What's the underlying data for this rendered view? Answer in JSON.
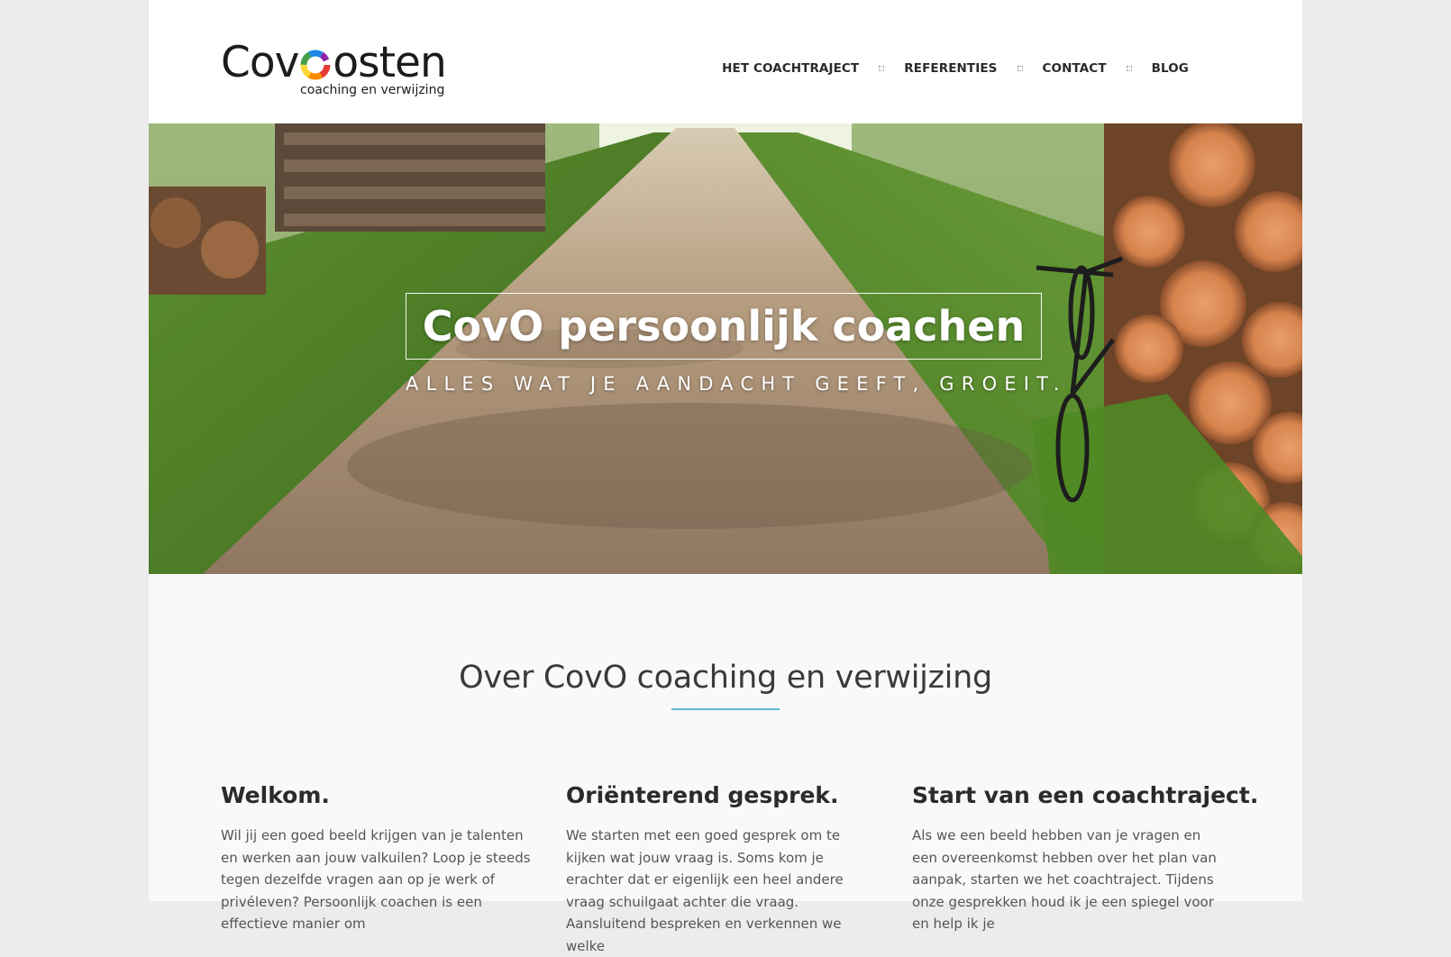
{
  "header": {
    "logo": {
      "word_start": "Cov",
      "word_end": "osten",
      "tagline": "coaching en verwijzing"
    },
    "nav": [
      {
        "label": "HET COACHTRAJECT"
      },
      {
        "label": "REFERENTIES"
      },
      {
        "label": "CONTACT"
      },
      {
        "label": "BLOG"
      }
    ]
  },
  "hero": {
    "title": "CovO persoonlijk coachen",
    "subtitle": "ALLES WAT JE AANDACHT GEEFT, GROEIT."
  },
  "about": {
    "title": "Over CovO coaching en verwijzing",
    "columns": [
      {
        "heading": "Welkom.",
        "text": "Wil jij een goed beeld krijgen van je talenten en werken aan jouw valkuilen? Loop je steeds tegen dezelfde vragen aan op je werk of privéleven? Persoonlijk coachen is een effectieve manier om"
      },
      {
        "heading": "Oriënterend gesprek.",
        "text": "We starten met een goed gesprek om te kijken wat jouw vraag is. Soms kom je erachter dat er eigenlijk een heel andere vraag schuilgaat achter die vraag. Aansluitend bespreken en verkennen we welke"
      },
      {
        "heading": "Start van een coachtraject.",
        "text": "Als we een beeld hebben van je vragen en een overeenkomst hebben over het plan van aanpak, starten we het coachtraject. Tijdens onze gesprekken houd ik je een spiegel voor en help ik je"
      }
    ]
  },
  "colors": {
    "accent": "#5cb8d6",
    "page_bg": "#faf9f9",
    "outer_bg": "#ececec",
    "text_dark": "#2b2b2b",
    "text_body": "#555555"
  },
  "icons": {
    "logo_ring": "rainbow-ring-icon",
    "nav_separator": "dotted-square-icon"
  }
}
